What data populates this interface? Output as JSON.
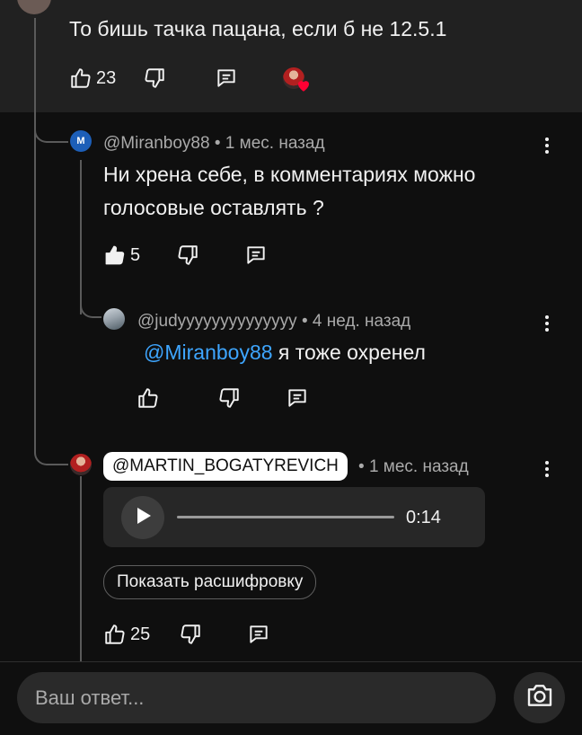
{
  "parent_comment": {
    "text": "То бишь тачка пацана, если б не 12.5.1",
    "likes": "23",
    "hearted": true
  },
  "replies": [
    {
      "avatar_letter": "M",
      "author": "@Miranboy88",
      "time": "1 мес. назад",
      "text": "Ни хрена себе, в комментариях можно голосовые оставлять ?",
      "likes": "5",
      "liked": true
    },
    {
      "author": "@judyyyyyyyyyyyyyy",
      "time": "4 нед. назад",
      "mention": "@Miranboy88",
      "text": "я тоже охренел",
      "likes": ""
    },
    {
      "author": "@MARTIN_BOGATYREVICH",
      "time": "1 мес. назад",
      "voice_duration": "0:14",
      "transcript_button": "Показать расшифровку",
      "likes": "25"
    }
  ],
  "separator": "•",
  "reply_box": {
    "placeholder": "Ваш ответ..."
  },
  "icons": {
    "like": "thumb-up-icon",
    "dislike": "thumb-down-icon",
    "reply": "reply-icon",
    "more": "more-vertical-icon",
    "play": "play-icon",
    "camera": "camera-icon",
    "heart": "heart-icon"
  },
  "colors": {
    "mention": "#3ea6ff",
    "heart": "#ff0033",
    "background": "#0f0f0f"
  }
}
